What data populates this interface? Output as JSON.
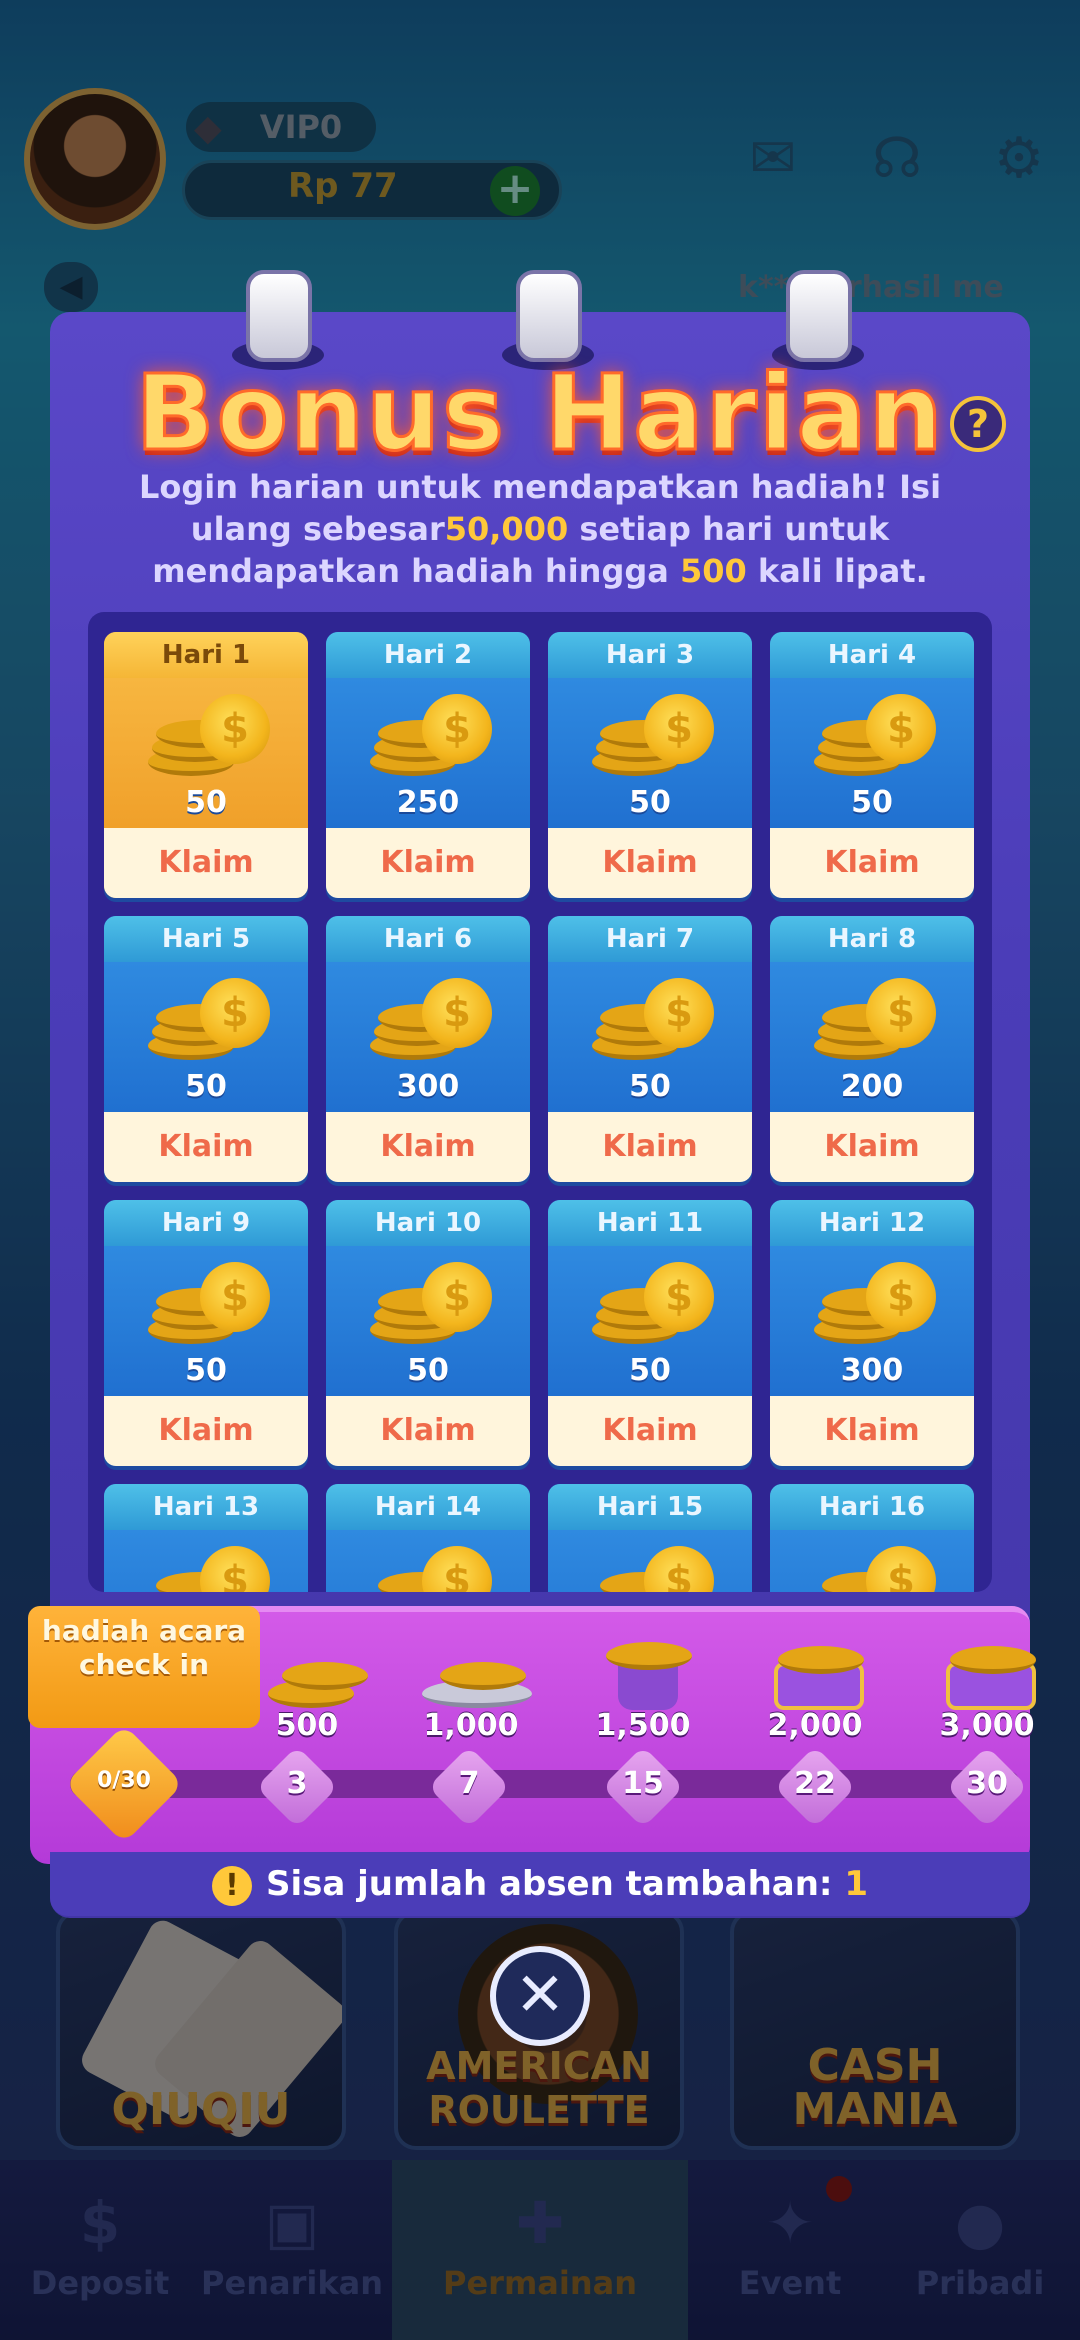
{
  "header": {
    "vip_label": "VIP0",
    "balance": "Rp 77",
    "ticker_text": "k***berhasil me"
  },
  "modal": {
    "title": "Bonus Harian",
    "help": "?",
    "desc_part1": "Login harian untuk mendapatkan hadiah! Isi ulang sebesar",
    "desc_amount": "50,000",
    "desc_part2": " setiap hari untuk mendapatkan hadiah hingga ",
    "desc_multiplier": "500",
    "desc_part3": " kali lipat.",
    "claim_label": "Klaim",
    "days": [
      {
        "label": "Hari 1",
        "amount": "50",
        "active": true
      },
      {
        "label": "Hari 2",
        "amount": "250"
      },
      {
        "label": "Hari 3",
        "amount": "50"
      },
      {
        "label": "Hari 4",
        "amount": "50"
      },
      {
        "label": "Hari 5",
        "amount": "50"
      },
      {
        "label": "Hari 6",
        "amount": "300"
      },
      {
        "label": "Hari 7",
        "amount": "50"
      },
      {
        "label": "Hari 8",
        "amount": "200"
      },
      {
        "label": "Hari 9",
        "amount": "50"
      },
      {
        "label": "Hari 10",
        "amount": "50"
      },
      {
        "label": "Hari 11",
        "amount": "50"
      },
      {
        "label": "Hari 12",
        "amount": "300"
      },
      {
        "label": "Hari 13",
        "amount": ""
      },
      {
        "label": "Hari 14",
        "amount": ""
      },
      {
        "label": "Hari 15",
        "amount": ""
      },
      {
        "label": "Hari 16",
        "amount": ""
      }
    ]
  },
  "checkin": {
    "label": "hadiah acara check in",
    "progress": "0/30",
    "rewards": [
      "500",
      "1,000",
      "1,500",
      "2,000",
      "3,000"
    ],
    "milestones": [
      "3",
      "7",
      "15",
      "22",
      "30"
    ],
    "remaining_label": "Sisa jumlah absen tambahan: ",
    "remaining_count": "1"
  },
  "games": [
    "QIUQIU",
    "AMERICAN ROULETTE",
    "CASH MANIA"
  ],
  "nav": [
    "Deposit",
    "Penarikan",
    "Permainan",
    "Event",
    "Pribadi"
  ],
  "colors": {
    "accent": "#ffc83a",
    "claim": "#ef6a4a",
    "modal": "#4b3db8"
  }
}
